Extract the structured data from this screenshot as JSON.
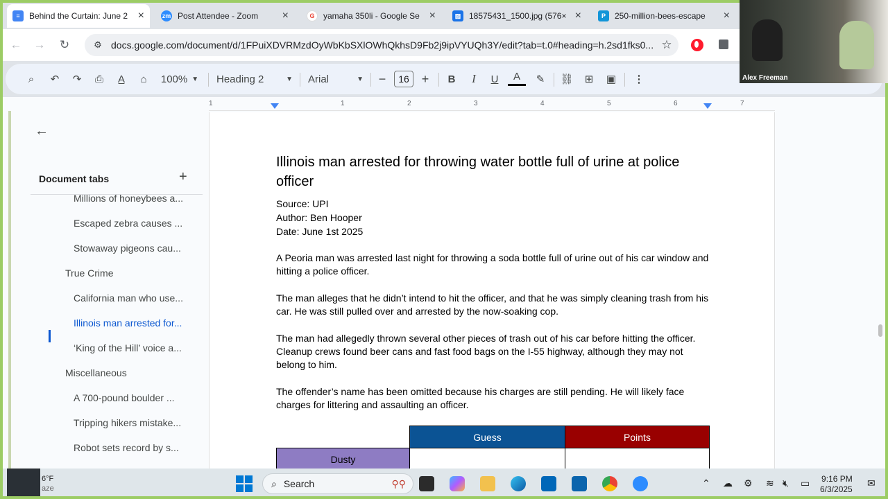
{
  "tabs": [
    {
      "title": "Behind the Curtain: June 2",
      "favicon": "docs-icon",
      "color": "#4285f4",
      "active": true
    },
    {
      "title": "Post Attendee - Zoom",
      "favicon": "zoom-icon",
      "color": "#2d8cff",
      "glyph": "zm",
      "active": false
    },
    {
      "title": "yamaha 350li - Google Se",
      "favicon": "google-icon",
      "color": "#ea4335",
      "glyph": "G",
      "active": false
    },
    {
      "title": "18575431_1500.jpg (576×",
      "favicon": "image-icon",
      "color": "#1a73e8",
      "active": false
    },
    {
      "title": "250-million-bees-escape",
      "favicon": "pinterest-like-icon",
      "color": "#1295d8",
      "glyph": "P",
      "active": false
    }
  ],
  "address": {
    "url": "docs.google.com/document/d/1FPuiXDVRMzdOyWbKbSXlOWhQkhsD9Fb2j9ipVYUQh3Y/edit?tab=t.0#heading=h.2sd1fks0..."
  },
  "toolbar": {
    "zoom": "100%",
    "style": "Heading 2",
    "font": "Arial",
    "font_size": "16"
  },
  "ruler": {
    "numbers": [
      "1",
      "1",
      "2",
      "3",
      "4",
      "5",
      "6",
      "7"
    ]
  },
  "sidebar": {
    "title": "Document tabs",
    "items": [
      {
        "label": "Millions of honeybees a...",
        "level": "sub"
      },
      {
        "label": "Escaped zebra causes ...",
        "level": "sub"
      },
      {
        "label": "Stowaway pigeons cau...",
        "level": "sub"
      },
      {
        "label": "True Crime",
        "level": "sec"
      },
      {
        "label": "California man who use...",
        "level": "sub"
      },
      {
        "label": "Illinois man arrested for...",
        "level": "sub",
        "current": true
      },
      {
        "label": "‘King of the Hill’ voice a...",
        "level": "sub"
      },
      {
        "label": "Miscellaneous",
        "level": "sec"
      },
      {
        "label": "A 700-pound boulder ...",
        "level": "sub"
      },
      {
        "label": "Tripping hikers mistake...",
        "level": "sub"
      },
      {
        "label": "Robot sets record by s...",
        "level": "sub"
      }
    ]
  },
  "doc": {
    "heading": "Illinois man arrested for throwing water bottle full of urine at police officer",
    "source": "Source: UPI",
    "author": "Author: Ben Hooper",
    "date": "Date: June 1st 2025",
    "paragraphs": [
      "A Peoria man was arrested last night for throwing a soda bottle full of urine out of his car window and hitting a police officer.",
      "The man alleges that he didn’t intend to hit the officer, and that he was simply cleaning trash from his car. He was still pulled over and arrested by the now-soaking cop.",
      "The man had allegedly thrown several other pieces of trash out of his car before hitting the officer. Cleanup crews found beer cans and fast food bags on the I-55 highway, although they may not belong to him.",
      "The offender’s name has been omitted because his charges are still pending. He will likely face charges for littering and assaulting an officer."
    ],
    "table": {
      "headers": [
        "Guess",
        "Points"
      ],
      "rows": [
        {
          "player": "Dusty",
          "guess": "",
          "points": ""
        }
      ]
    }
  },
  "video": {
    "name": "Alex Freeman"
  },
  "taskbar": {
    "weather_temp": "6°F",
    "weather_desc": "aze",
    "search": "Search",
    "time": "9:16 PM",
    "date": "6/3/2025"
  }
}
